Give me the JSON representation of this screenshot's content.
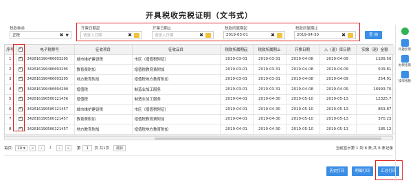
{
  "page": {
    "title": "开具税收完税证明（文书式）"
  },
  "filters": {
    "tax_type": {
      "label": "税款种类",
      "value": "正税"
    },
    "fill_date_start": {
      "label": "开票日期起",
      "placeholder": "请录入日期"
    },
    "fill_date_end": {
      "label": "开票日期止",
      "placeholder": "请录入日期"
    },
    "period_start": {
      "label": "税款所属期起",
      "value": "2019-03-01"
    },
    "period_end": {
      "label": "税款所属期止",
      "value": "2019-04-30"
    },
    "query_label": "查 询"
  },
  "table": {
    "columns": [
      "序号",
      "",
      "电子税票号",
      "征收项目",
      "征收品目",
      "税款所属期起",
      "税款所属期止",
      "开票日期",
      "入（退）库日期",
      "实缴（退）金额"
    ],
    "rows": [
      [
        "1",
        "342016190400093205",
        "城市维护建设税",
        "市区（增值税附征）",
        "2019-03-01",
        "2019-03-31",
        "2019-04-08",
        "2019-04-09",
        "1189.56"
      ],
      [
        "2",
        "342016190400093205",
        "教育费附加",
        "增值税教育费附加",
        "2019-03-01",
        "2019-03-31",
        "2019-04-08",
        "2019-04-09",
        "509.81"
      ],
      [
        "3",
        "342016190400093205",
        "地方教育附加",
        "增值税地方教育附加",
        "2019-03-01",
        "2019-03-31",
        "2019-04-08",
        "2019-04-09",
        "254.91"
      ],
      [
        "4",
        "342016190400094200",
        "增值税",
        "制造业加工服务",
        "2019-03-01",
        "2019-03-31",
        "2019-04-08",
        "2019-04-09",
        "16993.76"
      ],
      [
        "5",
        "342016190500121456",
        "增值税",
        "制造业加工服务",
        "2019-04-01",
        "2019-04-30",
        "2019-05-10",
        "2019-05-13",
        "12325.7"
      ],
      [
        "6",
        "342016190500121457",
        "城市维护建设税",
        "市区（增值税附征）",
        "2019-04-01",
        "2019-04-30",
        "2019-05-10",
        "2019-05-13",
        "863.87"
      ],
      [
        "7",
        "342016190500121457",
        "教育费附加",
        "增值税教育费附加",
        "2019-04-01",
        "2019-04-30",
        "2019-05-10",
        "2019-05-13",
        "370.23"
      ],
      [
        "8",
        "342016190500121457",
        "地方教育附加",
        "增值税地方教育附加",
        "2019-04-01",
        "2019-04-30",
        "2019-05-10",
        "2019-05-13",
        "185.12"
      ]
    ]
  },
  "pager": {
    "page_size_label": "每页:",
    "page_size": "10",
    "first": "«",
    "prev": "‹",
    "page_num": "1",
    "next": "›",
    "last": "»",
    "page_prefix": "第",
    "page_input": "1",
    "page_suffix": "页 共1页",
    "go": "跳转",
    "info": "当前显示第 1 到 8 条,共 8 条记录"
  },
  "actions": {
    "history_print": "历史打印",
    "detail_print": "明细打印",
    "summary_print": "汇总打印"
  },
  "sidebar": {
    "items": [
      "问题反馈",
      "办税指南",
      "操作视频"
    ]
  }
}
